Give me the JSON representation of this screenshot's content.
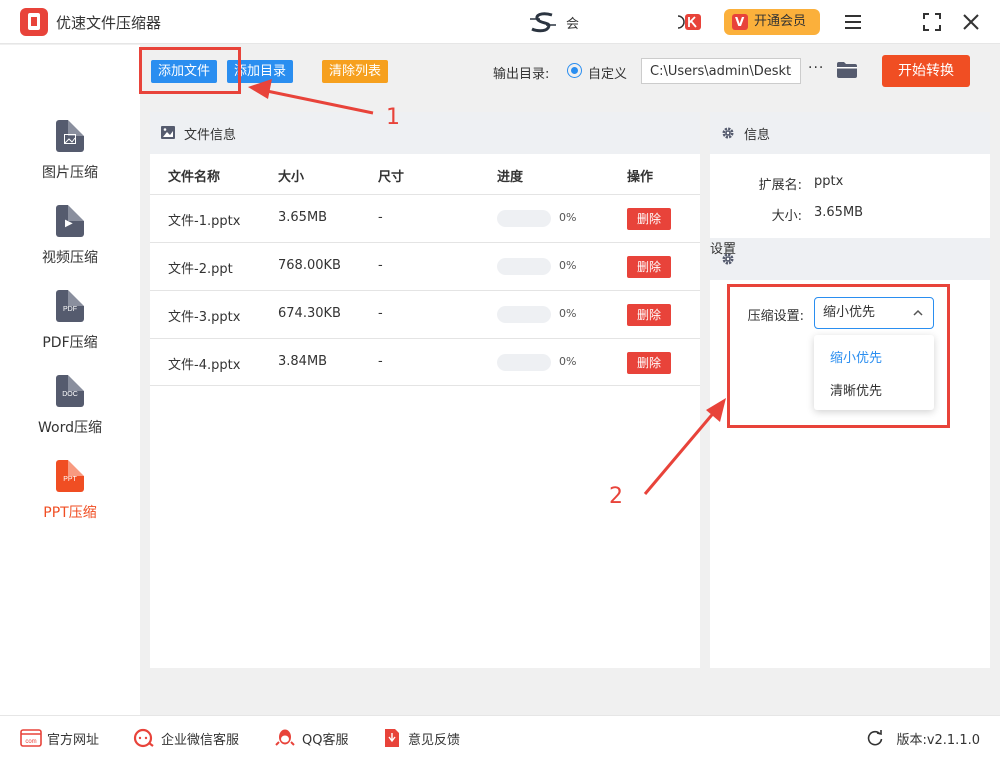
{
  "app": {
    "title": "优速文件压缩器",
    "mid_text": "会",
    "vip_label": "开通会员"
  },
  "sidebar": {
    "items": [
      {
        "label": "图片压缩",
        "tag": ""
      },
      {
        "label": "视频压缩",
        "tag": ""
      },
      {
        "label": "PDF压缩",
        "tag": "PDF"
      },
      {
        "label": "Word压缩",
        "tag": "DOC"
      },
      {
        "label": "PPT压缩",
        "tag": "PPT"
      }
    ],
    "active": "PPT压缩"
  },
  "toolbar": {
    "add_file": "添加文件",
    "add_dir": "添加目录",
    "clear_list": "清除列表",
    "output_label": "输出目录:",
    "custom_label": "自定义",
    "output_path": "C:\\Users\\admin\\Deskto",
    "more": "···",
    "start": "开始转换"
  },
  "file_panel": {
    "title": "文件信息",
    "columns": [
      "文件名称",
      "大小",
      "尺寸",
      "进度",
      "操作"
    ],
    "rows": [
      {
        "name": "文件-1.pptx",
        "size": "3.65MB",
        "dim": "-",
        "progress": "0%",
        "action": "删除"
      },
      {
        "name": "文件-2.ppt",
        "size": "768.00KB",
        "dim": "-",
        "progress": "0%",
        "action": "删除"
      },
      {
        "name": "文件-3.pptx",
        "size": "674.30KB",
        "dim": "-",
        "progress": "0%",
        "action": "删除"
      },
      {
        "name": "文件-4.pptx",
        "size": "3.84MB",
        "dim": "-",
        "progress": "0%",
        "action": "删除"
      }
    ]
  },
  "info_panel": {
    "title": "信息",
    "ext_label": "扩展名:",
    "ext_value": "pptx",
    "size_label": "大小:",
    "size_value": "3.65MB",
    "settings_title": "设置",
    "compress_label": "压缩设置:",
    "selected": "缩小优先",
    "options": [
      "缩小优先",
      "清晰优先"
    ]
  },
  "annotations": {
    "one": "1",
    "two": "2"
  },
  "footer": {
    "website": "官方网址",
    "wechat": "企业微信客服",
    "qq": "QQ客服",
    "feedback": "意见反馈",
    "version": "版本:v2.1.1.0"
  },
  "colors": {
    "accent_red": "#f04e23",
    "blue": "#2a8ef0",
    "orange": "#f6a01e",
    "vip": "#fbb03b"
  }
}
